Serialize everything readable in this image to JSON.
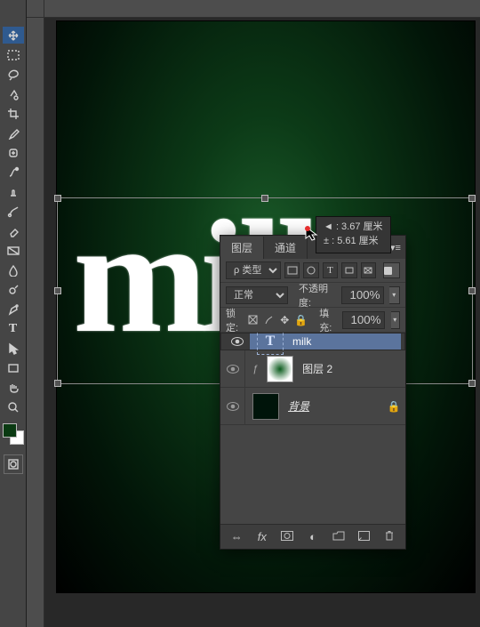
{
  "canvas": {
    "text": "milk"
  },
  "tooltip": {
    "line1": "◄ : 3.67 厘米",
    "line2": "± : 5.61 厘米"
  },
  "tools": {
    "foreground_color": "#0a3a12",
    "background_color": "#ffffff"
  },
  "panel": {
    "tabs": {
      "layers": "图层",
      "channels": "通道"
    },
    "filter": {
      "kind": "ρ 类型"
    },
    "blend": {
      "mode": "正常",
      "opacity_label": "不透明度:",
      "opacity": "100%"
    },
    "lock": {
      "label": "锁定:",
      "fill_label": "填充:",
      "fill": "100%"
    },
    "layers": [
      {
        "name": "milk",
        "kind": "type",
        "selected": true
      },
      {
        "name": "图层 2",
        "kind": "raster",
        "selected": false
      },
      {
        "name": "背景",
        "kind": "bg",
        "selected": false,
        "locked": true
      }
    ]
  }
}
